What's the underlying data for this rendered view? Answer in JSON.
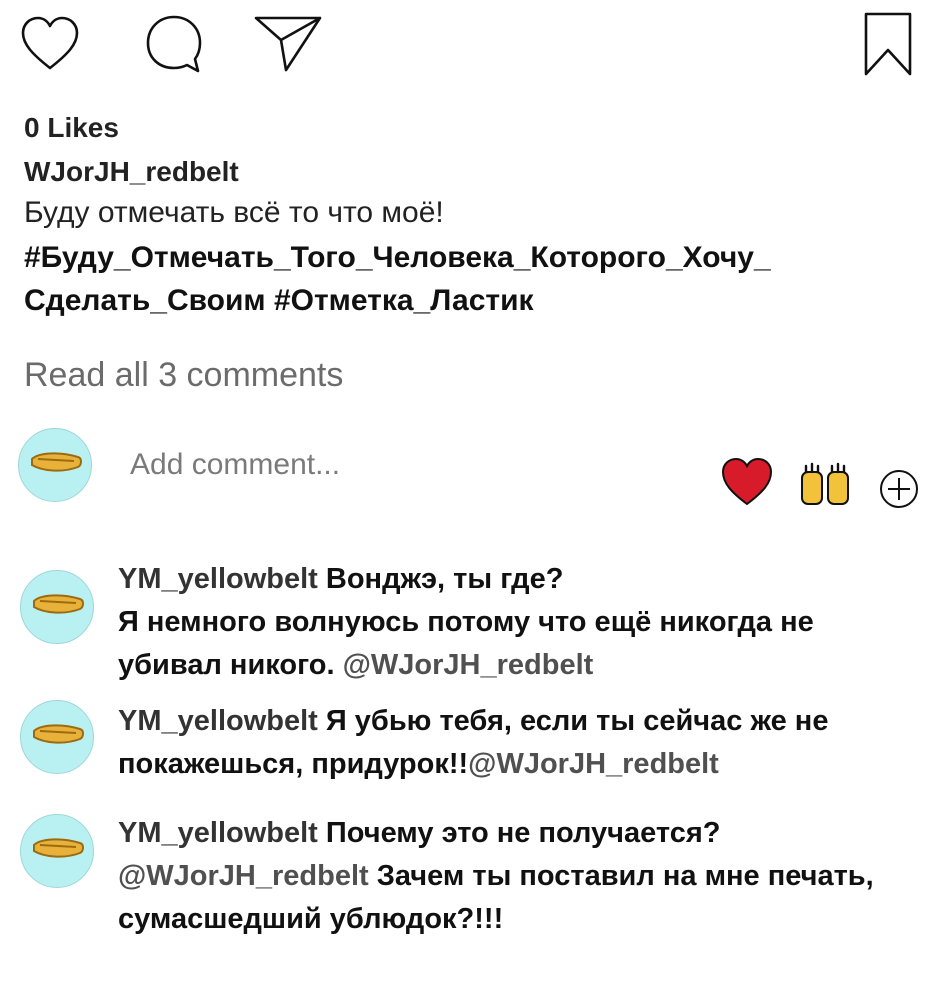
{
  "actions": {
    "like_icon": "heart-outline-icon",
    "comment_icon": "comment-bubble-icon",
    "share_icon": "paper-plane-icon",
    "save_icon": "bookmark-icon"
  },
  "post": {
    "likes": "0 Likes",
    "author": "WJorJH_redbelt",
    "caption": "Буду отмечать всё то что моё!",
    "hashtags": "#Буду_Отмечать_Того_Человека_Которого_Хочу_ Сделать_Своим #Отметка_Ластик",
    "read_all": "Read all 3 comments"
  },
  "composer": {
    "placeholder": "Add comment...",
    "quick_reactions": [
      "heart-emoji",
      "raised-hands-emoji",
      "add-reaction-icon"
    ]
  },
  "comments": [
    {
      "user": "YM_yellowbelt",
      "text_1": "Вонджэ, ты где?\nЯ немного волнуюсь потому что ещё никогда не убивал никого. ",
      "mention": "@WJorJH_redbelt",
      "text_2": ""
    },
    {
      "user": "YM_yellowbelt",
      "text_1": "Я убью тебя, если ты сейчас же не покажешься, придурок!!",
      "mention": "@WJorJH_redbelt",
      "text_2": ""
    },
    {
      "user": "YM_yellowbelt",
      "text_1": "Почему это не получается?\n",
      "mention": "@WJorJH_redbelt",
      "text_2": " Зачем ты поставил на мне печать, сумасшедший ублюдок?!!!"
    }
  ],
  "colors": {
    "avatar_bg": "#b9f1f2",
    "belt": "#e8b13a",
    "heart": "#d81b2a",
    "mention": "#505050"
  }
}
